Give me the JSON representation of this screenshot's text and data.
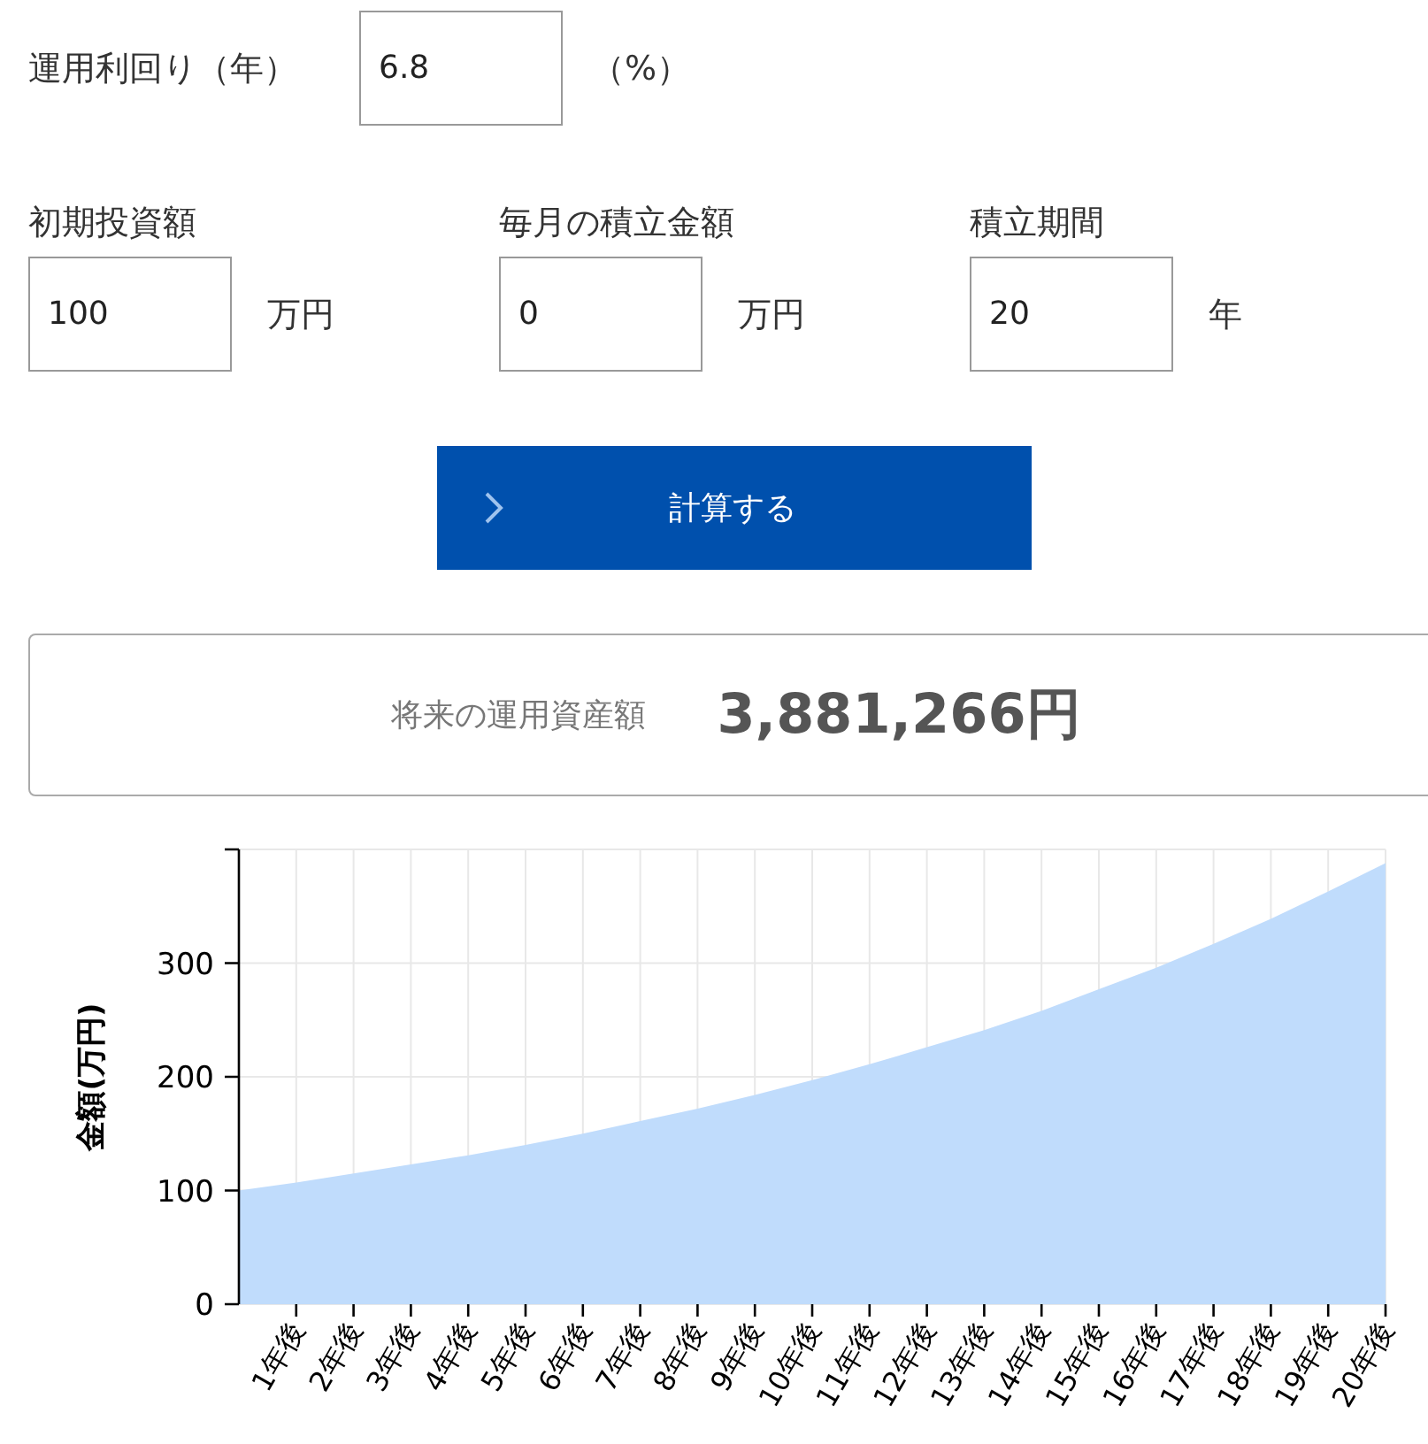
{
  "rate": {
    "label": "運用利回り（年）",
    "value": "6.8",
    "unit": "（%）"
  },
  "inputs": [
    {
      "label": "初期投資額",
      "value": "100",
      "unit": "万円"
    },
    {
      "label": "毎月の積立金額",
      "value": "0",
      "unit": "万円"
    },
    {
      "label": "積立期間",
      "value": "20",
      "unit": "年"
    }
  ],
  "button": {
    "label": "計算する"
  },
  "result": {
    "label": "将来の運用資産額",
    "value": "3,881,266円"
  },
  "chart": {
    "chart_data": {
      "type": "area",
      "ylabel": "金額(万円)",
      "x": [
        0,
        1,
        2,
        3,
        4,
        5,
        6,
        7,
        8,
        9,
        10,
        11,
        12,
        13,
        14,
        15,
        16,
        17,
        18,
        19,
        20
      ],
      "series": [
        {
          "color": "#c0dcfc",
          "values": [
            100,
            107,
            115,
            123,
            131,
            140,
            150,
            161,
            172,
            184,
            197,
            211,
            226,
            241,
            258,
            277,
            296,
            317,
            339,
            363,
            388
          ]
        }
      ],
      "grid": true,
      "xlim": [
        0,
        20
      ],
      "ylim": [
        0,
        400
      ],
      "xticks": [
        {
          "value": 1,
          "label": "1年後"
        },
        {
          "value": 2,
          "label": "2年後"
        },
        {
          "value": 3,
          "label": "3年後"
        },
        {
          "value": 4,
          "label": "4年後"
        },
        {
          "value": 5,
          "label": "5年後"
        },
        {
          "value": 6,
          "label": "6年後"
        },
        {
          "value": 7,
          "label": "7年後"
        },
        {
          "value": 8,
          "label": "8年後"
        },
        {
          "value": 9,
          "label": "9年後"
        },
        {
          "value": 10,
          "label": "10年後"
        },
        {
          "value": 11,
          "label": "11年後"
        },
        {
          "value": 12,
          "label": "12年後"
        },
        {
          "value": 13,
          "label": "13年後"
        },
        {
          "value": 14,
          "label": "14年後"
        },
        {
          "value": 15,
          "label": "15年後"
        },
        {
          "value": 16,
          "label": "16年後"
        },
        {
          "value": 17,
          "label": "17年後"
        },
        {
          "value": 18,
          "label": "18年後"
        },
        {
          "value": 19,
          "label": "19年後"
        },
        {
          "value": 20,
          "label": "20年後"
        }
      ],
      "yticks": [
        0,
        100,
        200,
        300
      ]
    }
  }
}
